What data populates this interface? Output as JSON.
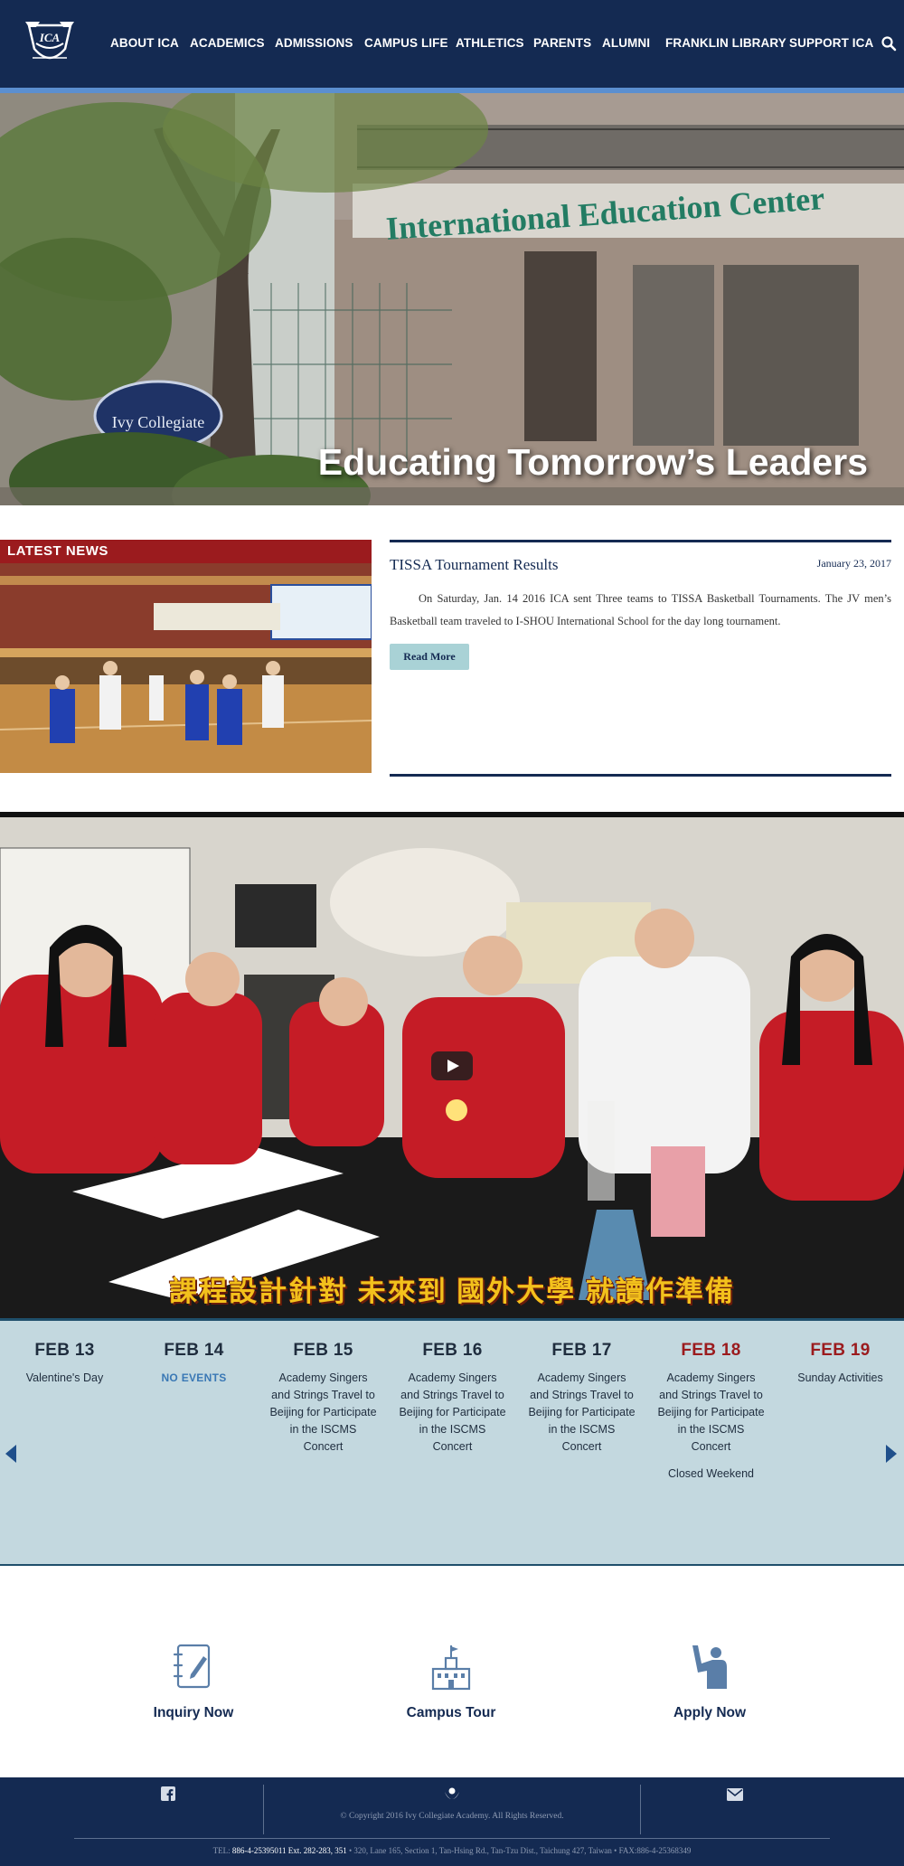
{
  "header": {
    "nav": [
      {
        "label": "ABOUT ICA"
      },
      {
        "label": "ACADEMICS"
      },
      {
        "label": "ADMISSIONS"
      },
      {
        "label": "CAMPUS LIFE"
      },
      {
        "label": "ATHLETICS"
      },
      {
        "label": "PARENTS"
      },
      {
        "label": "ALUMNI"
      },
      {
        "label": "FRANKLIN LIBRARY"
      },
      {
        "label": "SUPPORT ICA"
      }
    ],
    "logo_icon": "ica-crest-logo",
    "search_icon": "search-icon"
  },
  "hero": {
    "tagline": "Educating Tomorrow’s Leaders",
    "building_sign": "International Education Center",
    "school_sign": "Ivy Collegiate"
  },
  "news": {
    "badge": "LATEST NEWS",
    "title": "TISSA Tournament Results",
    "date": "January 23, 2017",
    "body": "On Saturday, Jan. 14 2016 ICA sent Three teams to TISSA Basketball Tournaments. The JV men’s Basketball team traveled to I-SHOU International School for the day long tournament.",
    "read_more": "Read More"
  },
  "video": {
    "caption": "課程設計針對 未來到 國外大學 就讀作準備"
  },
  "events": {
    "days": [
      {
        "date": "FEB 13",
        "weekend": false,
        "items": [
          "Valentine's Day"
        ]
      },
      {
        "date": "FEB 14",
        "weekend": false,
        "none": true,
        "items": [
          "NO EVENTS"
        ]
      },
      {
        "date": "FEB 15",
        "weekend": false,
        "items": [
          "Academy Singers and Strings Travel to Beijing for Participate in the ISCMS Concert"
        ]
      },
      {
        "date": "FEB 16",
        "weekend": false,
        "items": [
          "Academy Singers and Strings Travel to Beijing for Participate in the ISCMS Concert"
        ]
      },
      {
        "date": "FEB 17",
        "weekend": false,
        "items": [
          "Academy Singers and Strings Travel to Beijing for Participate in the ISCMS Concert"
        ]
      },
      {
        "date": "FEB 18",
        "weekend": true,
        "items": [
          "Academy Singers and Strings Travel to Beijing for Participate in the ISCMS Concert",
          "Closed Weekend"
        ]
      },
      {
        "date": "FEB 19",
        "weekend": true,
        "items": [
          "Sunday Activities"
        ]
      }
    ]
  },
  "cta": [
    {
      "label": "Inquiry Now",
      "icon": "notebook-pen-icon"
    },
    {
      "label": "Campus Tour",
      "icon": "campus-building-icon"
    },
    {
      "label": "Apply Now",
      "icon": "raised-hand-person-icon"
    }
  ],
  "footer": {
    "copyright": "© Copyright 2016 Ivy Collegiate Academy. All Rights Reserved.",
    "tel_label": "TEL:",
    "tel_number": "886-4-25395011 Ext. 282-283, 351",
    "address": "• 320, Lane 165, Section 1, Tan-Hsing Rd., Tan-Tzu Dist., Taichung 427, Taiwan • FAX:886-4-25368349"
  },
  "colors": {
    "navy": "#142a52",
    "accent_blue": "#5b8fd0",
    "crimson": "#9b1b1e",
    "events_bg": "#c3d8df",
    "read_more_bg": "#a9d2d6"
  }
}
